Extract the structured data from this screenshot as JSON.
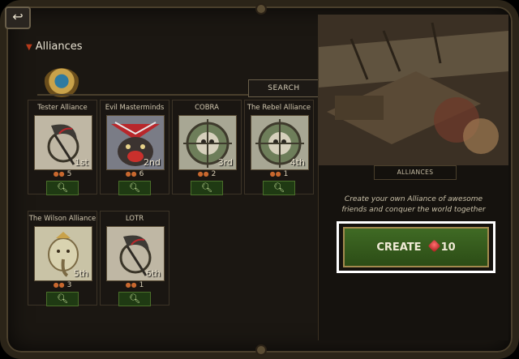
{
  "heading": "Alliances",
  "search_label": "SEARCH",
  "alliances": [
    {
      "name": "Tester Alliance",
      "rank": "1st",
      "members": "5"
    },
    {
      "name": "Evil Masterminds",
      "rank": "2nd",
      "members": "6"
    },
    {
      "name": "COBRA",
      "rank": "3rd",
      "members": "2"
    },
    {
      "name": "The Rebel Alliance",
      "rank": "4th",
      "members": "1"
    },
    {
      "name": "The Wilson Alliance",
      "rank": "5th",
      "members": "3"
    },
    {
      "name": "LOTR",
      "rank": "6th",
      "members": "1"
    }
  ],
  "art_caption": "ALLIANCES",
  "promo_line1": "Create your own Alliance of awesome",
  "promo_line2": "friends and conquer the world together",
  "create_label": "CREATE",
  "create_cost": "10",
  "colors": {
    "accent_green": "#2c4c16",
    "highlight": "#ffffff"
  }
}
